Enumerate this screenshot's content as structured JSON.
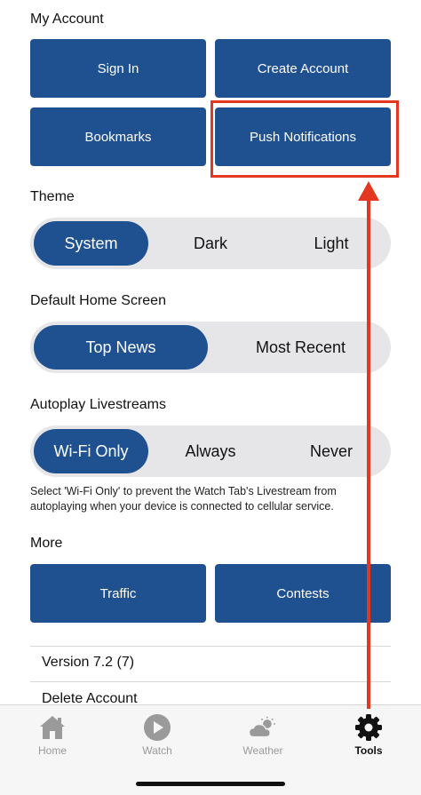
{
  "my_account": {
    "title": "My Account",
    "sign_in": "Sign In",
    "create_account": "Create Account",
    "bookmarks": "Bookmarks",
    "push_notifications": "Push Notifications"
  },
  "theme": {
    "title": "Theme",
    "options": [
      "System",
      "Dark",
      "Light"
    ],
    "selected": "System"
  },
  "home_screen": {
    "title": "Default Home Screen",
    "options": [
      "Top News",
      "Most Recent"
    ],
    "selected": "Top News"
  },
  "autoplay": {
    "title": "Autoplay Livestreams",
    "options": [
      "Wi-Fi Only",
      "Always",
      "Never"
    ],
    "selected": "Wi-Fi Only",
    "note_line1": "Select 'Wi-Fi Only' to prevent the Watch Tab's Livestream from",
    "note_line2": "autoplaying when your device is connected to cellular service."
  },
  "more": {
    "title": "More",
    "traffic": "Traffic",
    "contests": "Contests",
    "version": "Version 7.2 (7)",
    "delete_account": "Delete Account"
  },
  "tabbar": {
    "home": "Home",
    "watch": "Watch",
    "weather": "Weather",
    "tools": "Tools",
    "active": "tools"
  },
  "colors": {
    "accent": "#1f5190",
    "annotation": "#e3381f"
  }
}
